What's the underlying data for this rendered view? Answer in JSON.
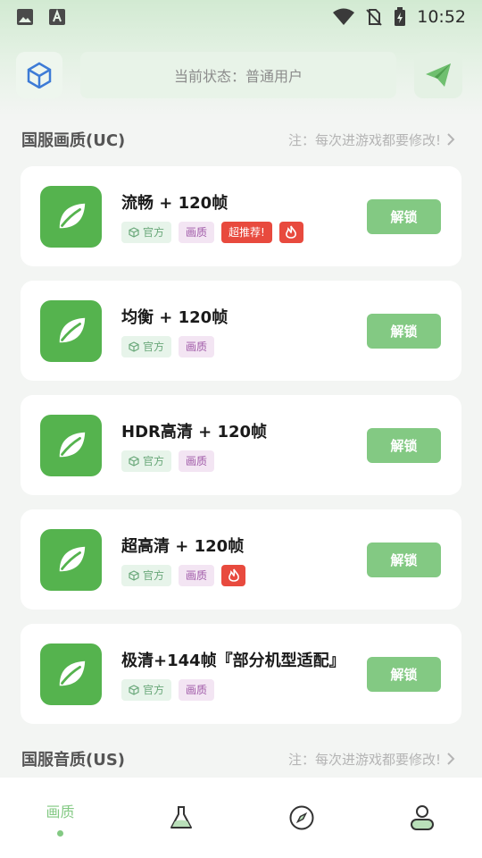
{
  "statusbar": {
    "time": "10:52",
    "icons": [
      "image-icon",
      "font-a-icon",
      "wifi-icon",
      "no-sim-icon",
      "battery-charging-icon"
    ]
  },
  "header": {
    "status_text": "当前状态：普通用户"
  },
  "section_uc": {
    "title": "国服画质(UC)",
    "note": "注：每次进游戏都要修改!"
  },
  "cards": [
    {
      "title": "流畅 + 120帧",
      "tag_official": "官方",
      "tag_quality": "画质",
      "tag_hot": "超推荐!",
      "unlock": "解锁"
    },
    {
      "title": "均衡 + 120帧",
      "tag_official": "官方",
      "tag_quality": "画质",
      "unlock": "解锁"
    },
    {
      "title": "HDR高清 + 120帧",
      "tag_official": "官方",
      "tag_quality": "画质",
      "unlock": "解锁"
    },
    {
      "title": "超高清 + 120帧",
      "tag_official": "官方",
      "tag_quality": "画质",
      "unlock": "解锁"
    },
    {
      "title": "极清+144帧『部分机型适配』",
      "tag_official": "官方",
      "tag_quality": "画质",
      "unlock": "解锁"
    }
  ],
  "section_us": {
    "title": "国服音质(US)",
    "note": "注：每次进游戏都要修改!"
  },
  "bottom_nav": {
    "items": [
      {
        "label": "画质",
        "icon": "quality-tab"
      },
      {
        "icon": "flask-icon"
      },
      {
        "icon": "compass-icon"
      },
      {
        "icon": "profile-icon"
      }
    ]
  },
  "colors": {
    "accent": "#83c983",
    "app_icon": "#55b34e",
    "hot_tag": "#e84a3e"
  }
}
